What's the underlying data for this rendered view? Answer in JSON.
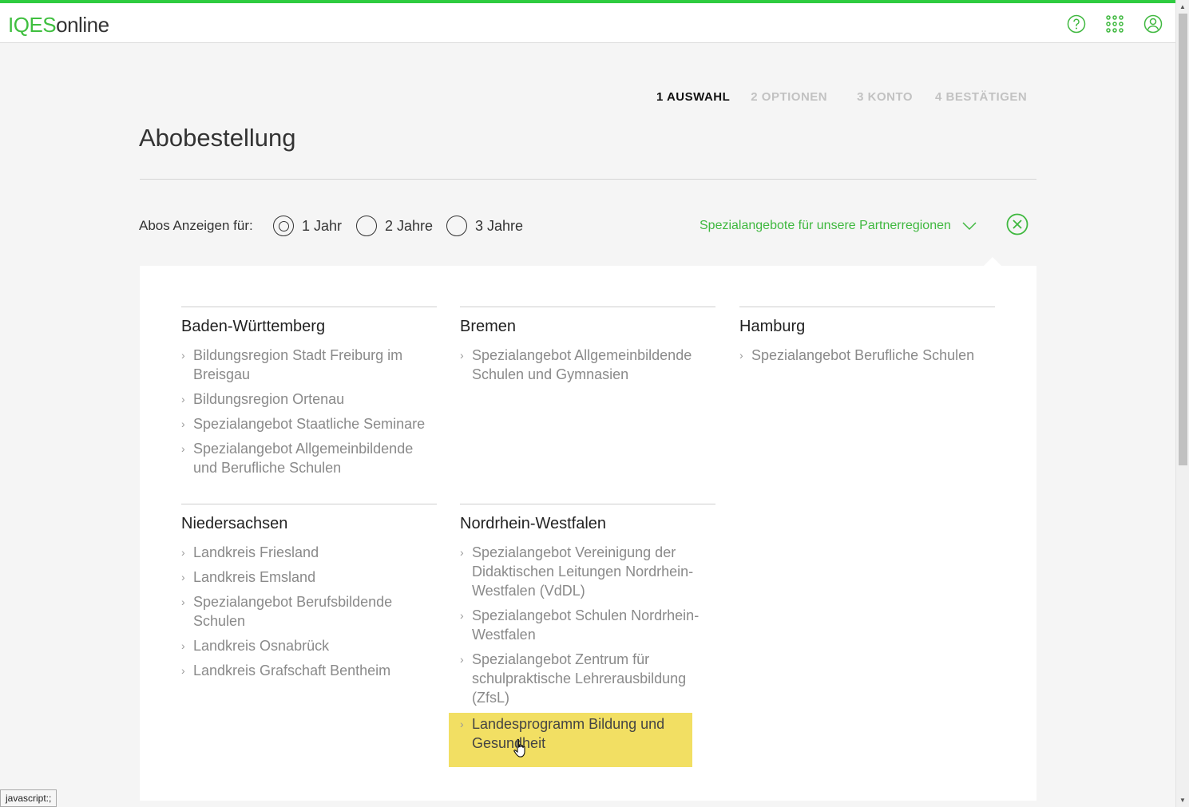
{
  "header": {
    "logo_iqes": "IQES",
    "logo_online": "online",
    "icons": [
      "help-icon",
      "apps-grid-icon",
      "user-icon"
    ]
  },
  "steps": [
    {
      "label": "1 AUSWAHL",
      "active": true
    },
    {
      "label": "2 OPTIONEN",
      "active": false
    },
    {
      "label": "3 KONTO",
      "active": false
    },
    {
      "label": "4 BESTÄTIGEN",
      "active": false
    }
  ],
  "page": {
    "title": "Abobestellung"
  },
  "filter": {
    "label": "Abos Anzeigen für:",
    "options": [
      "1 Jahr",
      "2 Jahre",
      "3 Jahre"
    ],
    "selected": "1 Jahr",
    "special_toggle": "Spezialangebote für unsere Partnerregionen"
  },
  "regions": [
    {
      "name": "Baden-Württemberg",
      "items": [
        "Bildungsregion Stadt Freiburg im Breisgau",
        "Bildungsregion Ortenau",
        "Spezialangebot Staatliche Seminare",
        "Spezialangebot Allgemeinbildende und Berufliche Schulen"
      ]
    },
    {
      "name": "Bremen",
      "items": [
        "Spezialangebot Allgemeinbildende Schulen und Gymnasien"
      ]
    },
    {
      "name": "Hamburg",
      "items": [
        "Spezialangebot Berufliche Schulen"
      ]
    },
    {
      "name": "Niedersachsen",
      "items": [
        "Landkreis Friesland",
        "Landkreis Emsland",
        "Spezialangebot Berufsbildende Schulen",
        "Landkreis Osnabrück",
        "Landkreis Grafschaft Bentheim"
      ]
    },
    {
      "name": "Nordrhein-Westfalen",
      "items": [
        "Spezialangebot Vereinigung der Didaktischen Leitungen Nordrhein-Westfalen (VdDL)",
        "Spezialangebot Schulen Nordrhein-Westfalen",
        "Spezialangebot Zentrum für schulpraktische Lehrerausbildung (ZfsL)",
        "Landesprogramm Bildung und Gesundheit"
      ]
    }
  ],
  "highlight_color": "#f2df63",
  "accent_color": "#3fb83f",
  "status_bar": "javascript:;"
}
